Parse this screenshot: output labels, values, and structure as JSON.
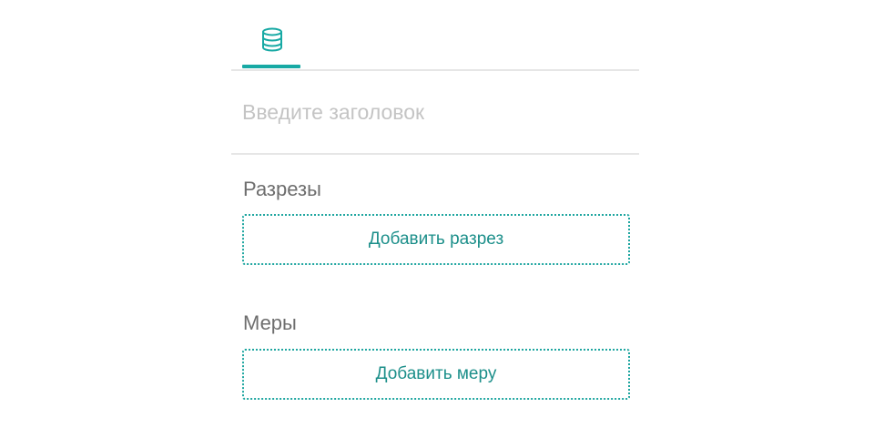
{
  "tabs": [
    {
      "icon": "database-icon",
      "active": true
    }
  ],
  "title_input": {
    "placeholder": "Введите заголовок",
    "value": ""
  },
  "dimensions": {
    "label": "Разрезы",
    "add_label": "Добавить разрез"
  },
  "measures": {
    "label": "Меры",
    "add_label": "Добавить меру"
  },
  "colors": {
    "accent": "#17a9a4",
    "divider": "#e6e6e6",
    "placeholder": "#c4c4c4",
    "label": "#6e6e6e"
  }
}
